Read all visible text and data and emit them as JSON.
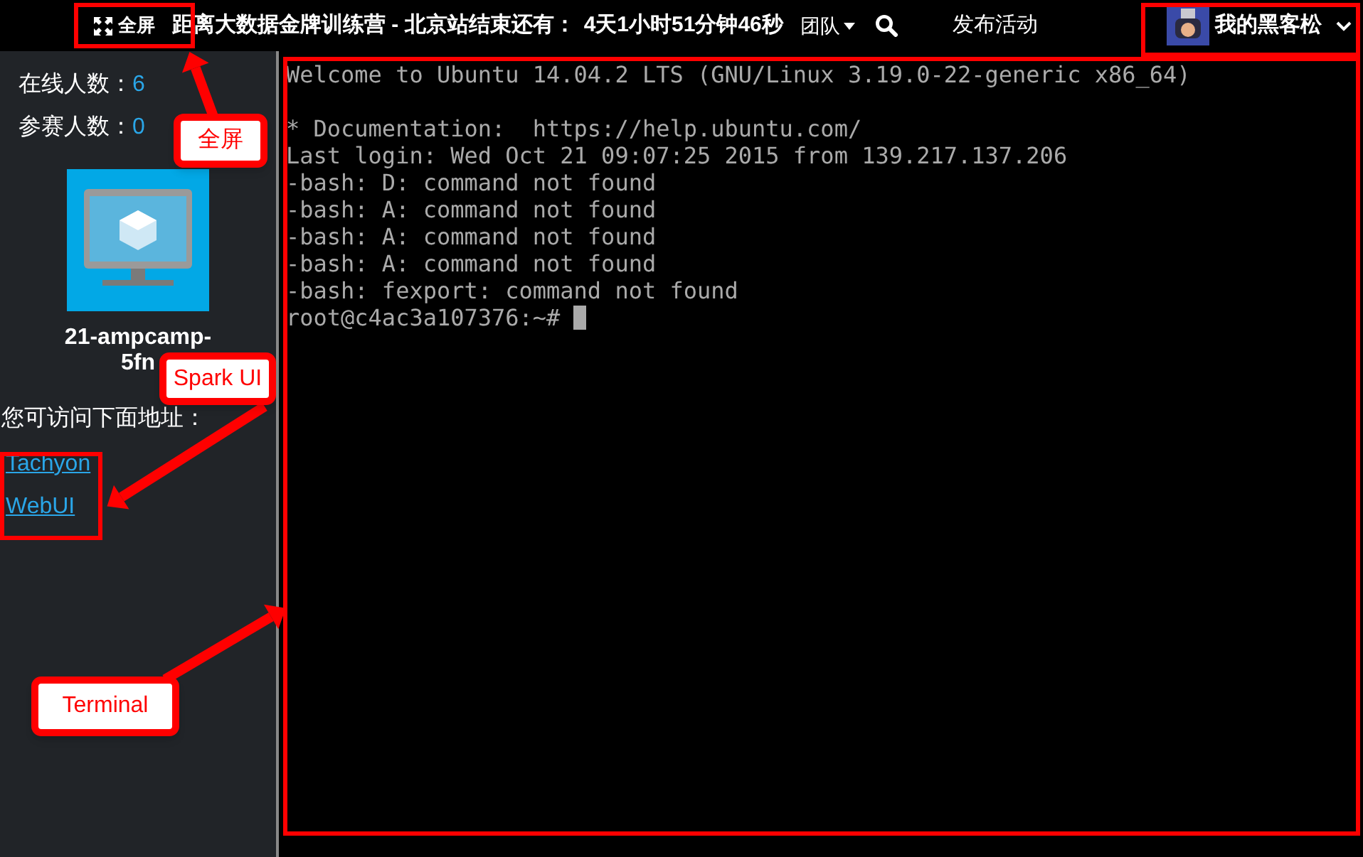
{
  "top_bar": {
    "fullscreen_button": "全屏",
    "countdown_label": "距离大数据金牌训练营 - 北京站结束还有：",
    "countdown_value": "4天1小时51分钟46秒",
    "team_menu": "团队",
    "publish_link": "发布活动",
    "user_name": "我的黑客松"
  },
  "sidebar": {
    "stats": [
      {
        "label": "在线人数：",
        "value": "6"
      },
      {
        "label": "参赛人数：",
        "value": "0"
      }
    ],
    "vm_name_lines": [
      "21-ampcamp-",
      "5fn"
    ],
    "links_caption": "您可访问下面地址：",
    "links": [
      "Tachyon",
      "WebUI"
    ]
  },
  "terminal": {
    "banner": "Welcome to Ubuntu 14.04.2 LTS (GNU/Linux 3.19.0-22-generic x86_64)",
    "lines": [
      "* Documentation:  https://help.ubuntu.com/",
      "Last login: Wed Oct 21 09:07:25 2015 from 139.217.137.206",
      "-bash: D: command not found",
      "-bash: A: command not found",
      "-bash: A: command not found",
      "-bash: A: command not found",
      "-bash: fexport: command not found"
    ],
    "prompt": "root@c4ac3a107376:~#"
  },
  "annotations": [
    {
      "label": "全屏"
    },
    {
      "label": "Spark UI"
    },
    {
      "label": "Terminal"
    }
  ]
}
